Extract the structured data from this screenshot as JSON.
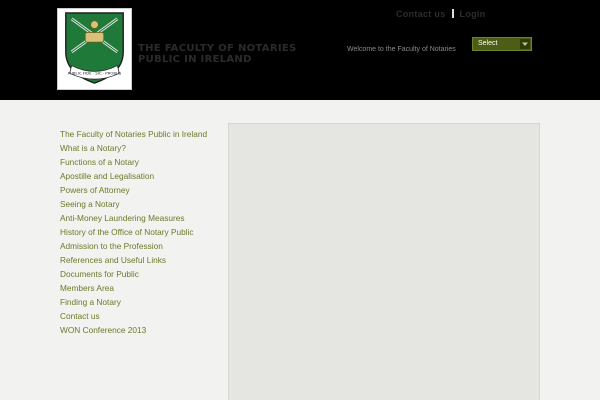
{
  "header": {
    "site_title": "The Faculty of Notaries Public in Ireland",
    "top_links": [
      "Contact us",
      "Login"
    ],
    "tagline": "Welcome to the Faculty of Notaries",
    "select_label": "Select",
    "crest_motto": "PUBLIC FIDE · SIC · PROBUS"
  },
  "sidebar": {
    "items": [
      "The Faculty of Notaries Public in Ireland",
      "What is a Notary?",
      "Functions of a Notary",
      "Apostille and Legalisation",
      "Powers of Attorney",
      "Seeing a Notary",
      "Anti-Money Laundering Measures",
      "History of the Office of Notary Public",
      "Admission to the Profession",
      "References and Useful Links",
      "Documents for Public",
      "Members Area",
      "Finding a Notary",
      "Contact us",
      "WON Conference 2013"
    ]
  },
  "colors": {
    "header_bg": "#000000",
    "page_bg": "#f2f2f0",
    "link_green": "#6b7a2a",
    "select_green": "#4b5e13",
    "crest_green": "#1f7a3a"
  }
}
